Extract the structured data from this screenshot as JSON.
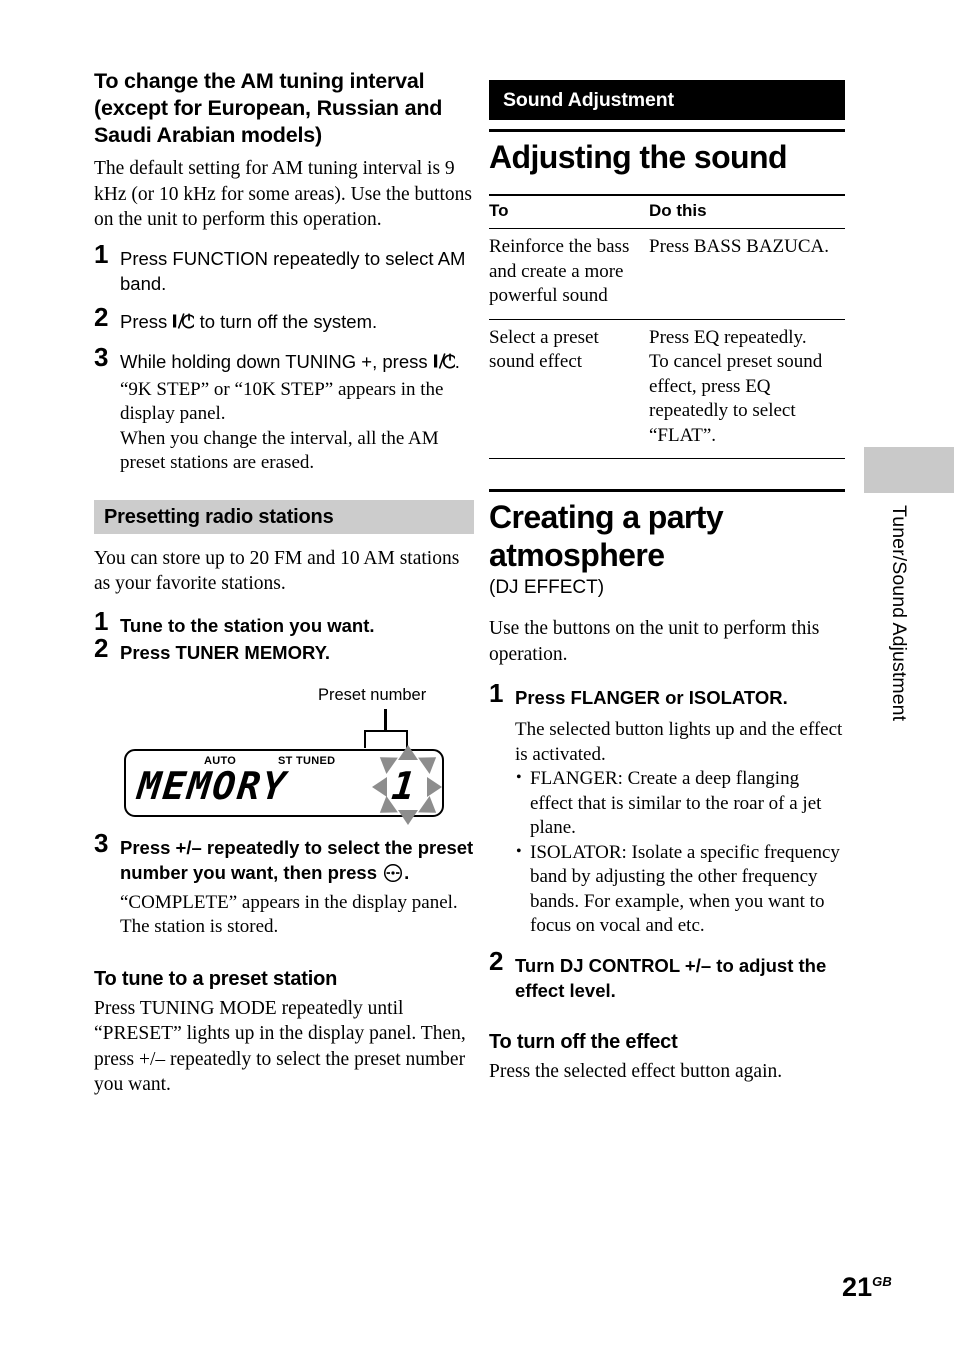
{
  "page": {
    "number": "21",
    "number_suffix": "GB",
    "side_tab_label": "Tuner/Sound Adjustment"
  },
  "left_column": {
    "section1": {
      "heading": "To change the AM tuning interval (except for European, Russian and Saudi Arabian models)",
      "intro": "The default setting for AM tuning interval is 9 kHz (or 10 kHz for some areas). Use the buttons on the unit to perform this operation.",
      "steps": [
        {
          "num": "1",
          "title": "Press FUNCTION repeatedly to select AM band.",
          "body": ""
        },
        {
          "num": "2",
          "title_pre": "Press ",
          "title_post": " to turn off the system.",
          "body": ""
        },
        {
          "num": "3",
          "title_pre": "While holding down TUNING +, press ",
          "title_post": ".",
          "body": "“9K STEP” or “10K STEP” appears in the display panel.\nWhen you change the interval, all the AM preset stations are erased."
        }
      ]
    },
    "section2": {
      "heading": "Presetting radio stations",
      "intro": "You can store up to 20 FM and 10 AM stations as your favorite stations.",
      "steps": [
        {
          "num": "1",
          "title": "Tune to the station you want."
        },
        {
          "num": "2",
          "title": "Press TUNER MEMORY."
        },
        {
          "num": "3",
          "title_pre": "Press +/– repeatedly to select the preset number you want, then press ",
          "title_post": ".",
          "body": "“COMPLETE” appears in the display panel. The station is stored."
        }
      ],
      "figure": {
        "caption": "Preset number",
        "indicator_auto": "AUTO",
        "indicator_st_tuned": "ST TUNED",
        "display_text": "MEMORY",
        "preset_digit": "1"
      }
    },
    "section3": {
      "heading": "To tune to a preset station",
      "body": "Press TUNING MODE repeatedly until “PRESET” lights up in the display panel. Then, press +/– repeatedly to select the preset number you want."
    }
  },
  "right_column": {
    "banner": "Sound Adjustment",
    "heading1": "Adjusting the sound",
    "table": {
      "headers": [
        "To",
        "Do this"
      ],
      "rows": [
        {
          "to": "Reinforce the bass and create a more powerful sound",
          "do": "Press BASS BAZUCA."
        },
        {
          "to": "Select a preset sound effect",
          "do": "Press EQ repeatedly.\nTo cancel preset sound effect, press EQ repeatedly to select “FLAT”."
        }
      ]
    },
    "heading2": "Creating a party atmosphere",
    "heading2_sub": "(DJ EFFECT)",
    "intro2": "Use the buttons on the unit to perform this operation.",
    "steps": [
      {
        "num": "1",
        "title": "Press FLANGER or ISOLATOR.",
        "body": "The selected button lights up and the effect is activated.",
        "bullets": [
          "FLANGER: Create a deep flanging effect that is similar to the roar of a jet plane.",
          "ISOLATOR: Isolate a specific frequency band by adjusting the other frequency bands. For example, when you want to focus on vocal and etc."
        ]
      },
      {
        "num": "2",
        "title": "Turn DJ CONTROL +/– to adjust the effect level.",
        "body": ""
      }
    ],
    "section_off": {
      "heading": "To turn off the effect",
      "body": "Press the selected effect button again."
    }
  },
  "colors": {
    "gray_subhead": "#cccccc",
    "banner_bg": "#000000",
    "thumb_tab": "#c9c9c9",
    "flash_arrow": "#8d8d8d"
  }
}
